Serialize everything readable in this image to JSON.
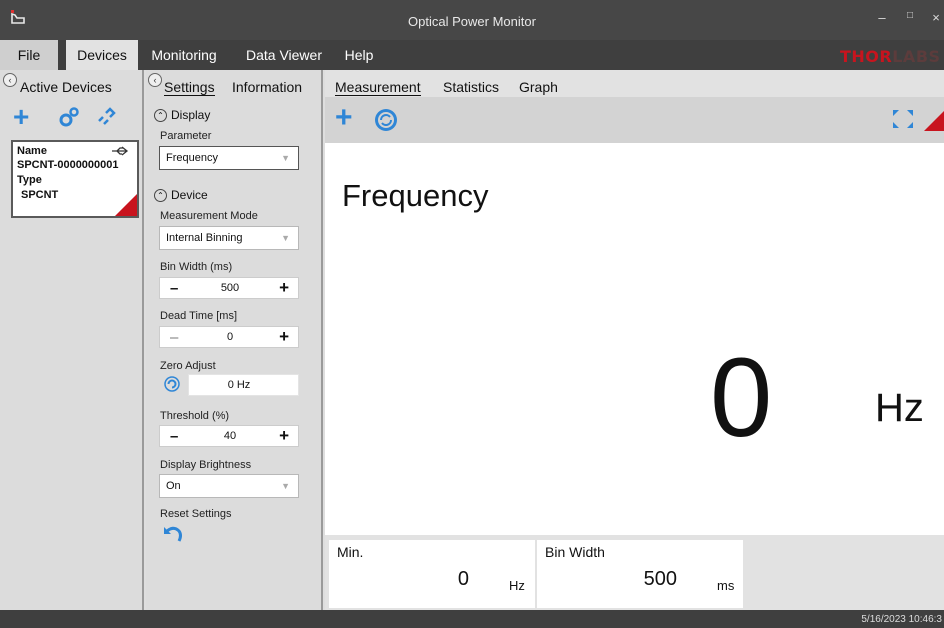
{
  "window": {
    "title": "Optical Power Monitor"
  },
  "menu": {
    "file": "File",
    "devices": "Devices",
    "monitoring": "Monitoring",
    "data_viewer": "Data Viewer",
    "help": "Help"
  },
  "brand": {
    "text_a": "THOR",
    "text_b": "LABS"
  },
  "active_devices": {
    "header": "Active Devices",
    "device": {
      "name_label": "Name",
      "name_value": "SPCNT-0000000001",
      "type_label": "Type",
      "type_value": "SPCNT"
    }
  },
  "settings": {
    "tabs": [
      "Settings",
      "Information"
    ],
    "display_section": "Display",
    "parameter_label": "Parameter",
    "parameter_value": "Frequency",
    "device_section": "Device",
    "measurement_mode_label": "Measurement Mode",
    "measurement_mode_value": "Internal Binning",
    "bin_width_label": "Bin Width (ms)",
    "bin_width_value": "500",
    "dead_time_label": "Dead Time [ms]",
    "dead_time_value": "0",
    "zero_adjust_label": "Zero Adjust",
    "zero_adjust_value": "0 Hz",
    "threshold_label": "Threshold (%)",
    "threshold_value": "40",
    "brightness_label": "Display Brightness",
    "brightness_value": "On",
    "reset_label": "Reset Settings"
  },
  "measurement": {
    "tabs": [
      "Measurement",
      "Statistics",
      "Graph"
    ],
    "parameter": "Frequency",
    "value": "0",
    "unit": "Hz",
    "stats": [
      {
        "name": "Min.",
        "value": "0",
        "unit": "Hz"
      },
      {
        "name": "Bin Width",
        "value": "500",
        "unit": "ms"
      }
    ]
  },
  "status": {
    "timestamp": "5/16/2023 10:46:3"
  },
  "colors": {
    "accent_red": "#c8141e",
    "icon_blue": "#2f86d6",
    "chrome_dark": "#3f3f3f"
  }
}
